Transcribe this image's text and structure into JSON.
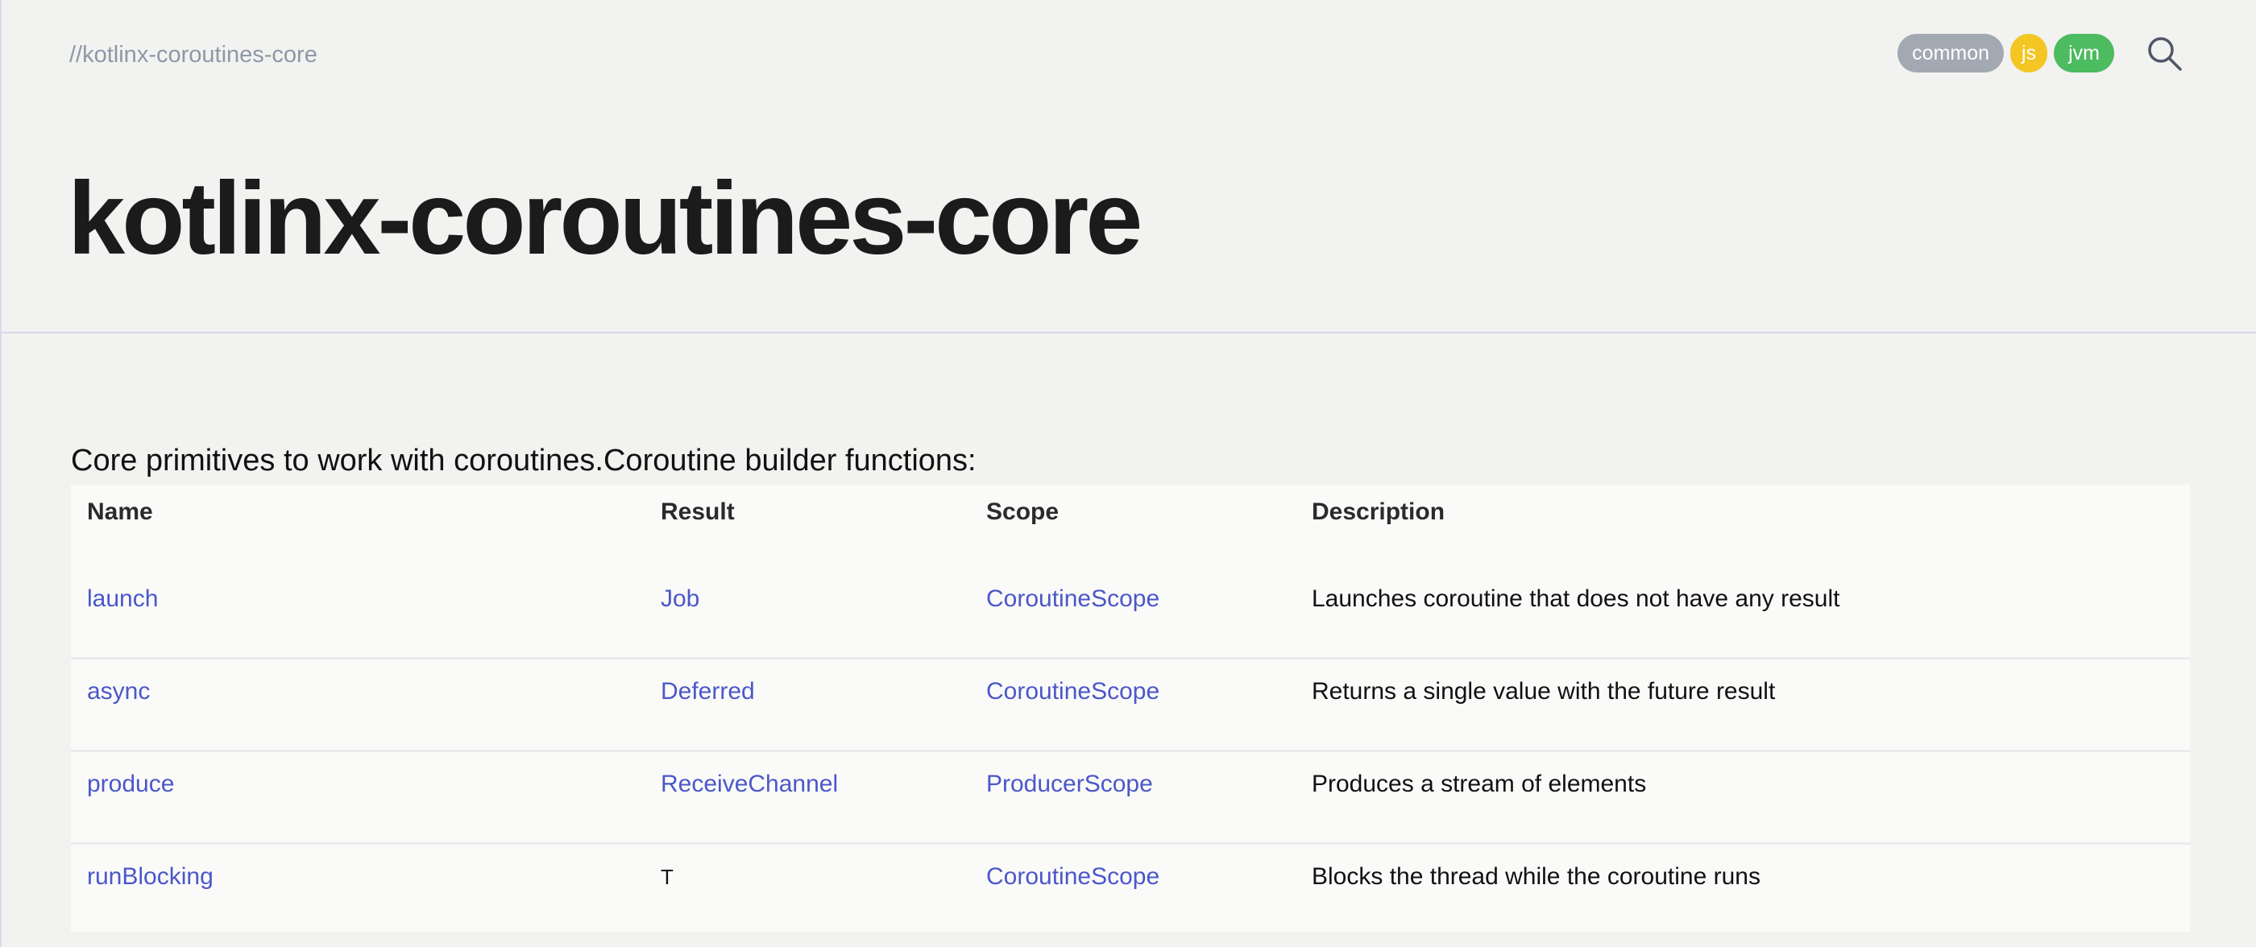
{
  "breadcrumb": "//kotlinx-coroutines-core",
  "platforms": [
    "common",
    "js",
    "jvm"
  ],
  "search_icon": "search-icon",
  "page_title": "kotlinx-coroutines-core",
  "intro": "Core primitives to work with coroutines.Coroutine builder functions:",
  "table": {
    "headers": [
      "Name",
      "Result",
      "Scope",
      "Description"
    ],
    "rows": [
      {
        "name": "launch",
        "result": "Job",
        "scope": "CoroutineScope",
        "description": "Launches coroutine that does not have any result"
      },
      {
        "name": "async",
        "result": "Deferred",
        "scope": "CoroutineScope",
        "description": "Returns a single value with the future result"
      },
      {
        "name": "produce",
        "result": "ReceiveChannel",
        "scope": "ProducerScope",
        "description": "Produces a stream of elements"
      },
      {
        "name": "runBlocking",
        "result": "T",
        "scope": "CoroutineScope",
        "description": "Blocks the thread while the coroutine runs"
      }
    ]
  },
  "colors": {
    "link": "#4b57c9",
    "common_badge": "#a3a9b3",
    "js_badge": "#f3c623",
    "jvm_badge": "#4dbb5f"
  }
}
